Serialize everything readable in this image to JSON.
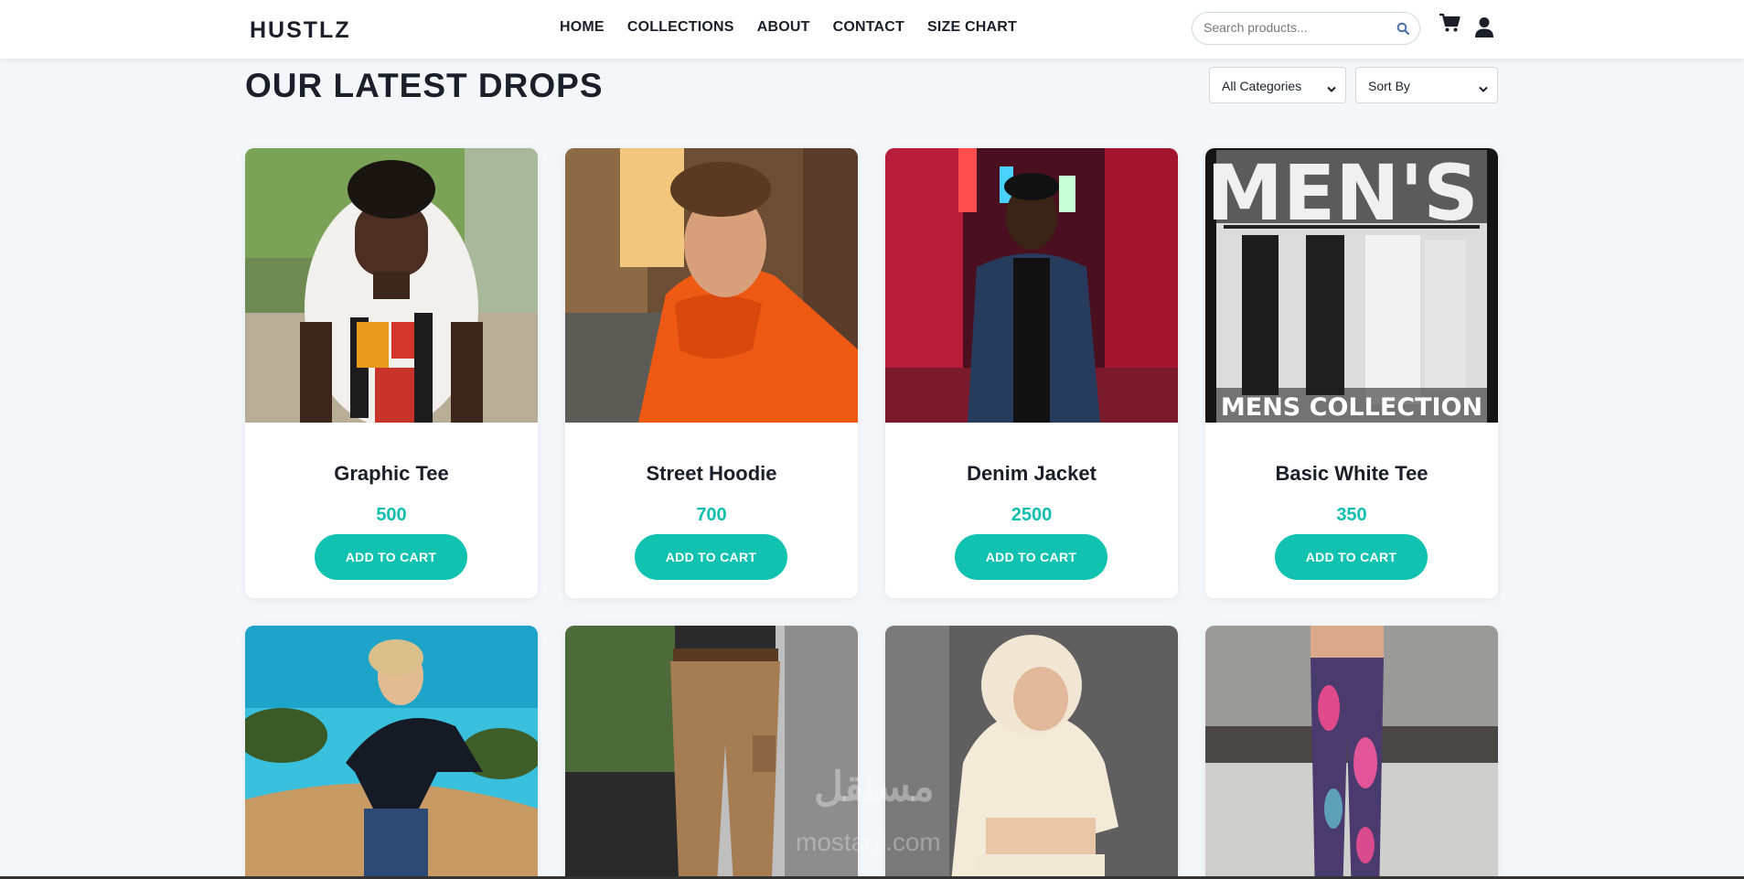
{
  "header": {
    "logo": "HUSTLZ",
    "nav": [
      "HOME",
      "COLLECTIONS",
      "ABOUT",
      "CONTACT",
      "SIZE CHART"
    ],
    "search_placeholder": "Search products...",
    "icons": [
      "search-icon",
      "cart-icon",
      "user-icon"
    ]
  },
  "main": {
    "title": "OUR LATEST DROPS",
    "category_select": "All Categories",
    "sort_select": "Sort By"
  },
  "products": [
    {
      "name": "Graphic Tee",
      "price": "500",
      "button": "ADD TO CART"
    },
    {
      "name": "Street Hoodie",
      "price": "700",
      "button": "ADD TO CART"
    },
    {
      "name": "Denim Jacket",
      "price": "2500",
      "button": "ADD TO CART"
    },
    {
      "name": "Basic White Tee",
      "price": "350",
      "button": "ADD TO CART",
      "image_text_top": "MEN'S",
      "image_text_bottom": "MENS COLLECTION"
    }
  ],
  "watermark": {
    "arabic": "مستقل",
    "latin": "mostaql.com"
  },
  "colors": {
    "accent": "#11c2b0",
    "price": "#10bfae",
    "text": "#1a1f29",
    "background": "#f3f7fa"
  }
}
